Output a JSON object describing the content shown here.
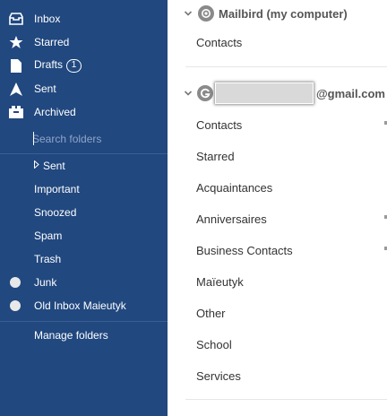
{
  "sidebar": {
    "main_items": [
      {
        "label": "Inbox",
        "icon": "inbox-icon"
      },
      {
        "label": "Starred",
        "icon": "star-icon"
      },
      {
        "label": "Drafts",
        "icon": "draft-icon",
        "badge": "1"
      },
      {
        "label": "Sent",
        "icon": "send-icon"
      },
      {
        "label": "Archived",
        "icon": "archive-icon"
      }
    ],
    "search_placeholder": "Search folders",
    "folders": [
      {
        "label": "Sent"
      },
      {
        "label": "Important"
      },
      {
        "label": "Snoozed"
      },
      {
        "label": "Spam"
      },
      {
        "label": "Trash"
      },
      {
        "label": "Junk"
      },
      {
        "label": "Old Inbox Maieutyk"
      }
    ],
    "manage_label": "Manage folders"
  },
  "main": {
    "account1": {
      "title": "Mailbird (my computer)",
      "folders": [
        "Contacts"
      ]
    },
    "account2": {
      "title_suffix": "@gmail.com",
      "folders": [
        "Contacts",
        "Starred",
        "Acquaintances",
        "Anniversaires",
        "Business Contacts",
        "Maïeutyk",
        "Other",
        "School",
        "Services"
      ]
    }
  },
  "colors": {
    "sidebar_bg": "#21487f",
    "account_logo": "#8a8a8a"
  }
}
